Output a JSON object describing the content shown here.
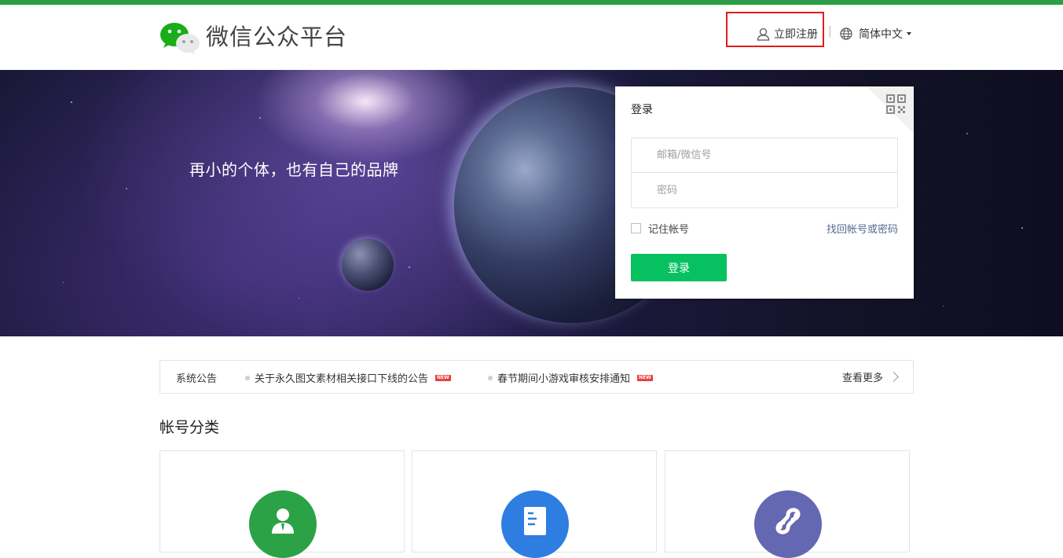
{
  "header": {
    "brand_name": "微信公众平台",
    "register_label": "立即注册",
    "separator": "|",
    "language": "简体中文"
  },
  "banner": {
    "slogan": "再小的个体，也有自己的品牌"
  },
  "login": {
    "title": "登录",
    "email_placeholder": "邮箱/微信号",
    "password_placeholder": "密码",
    "remember_label": "记住帐号",
    "forgot_label": "找回帐号或密码",
    "submit_label": "登录"
  },
  "notices": {
    "label": "系统公告",
    "items": [
      {
        "text": "关于永久图文素材相关接口下线的公告",
        "badge": "NEW"
      },
      {
        "text": "春节期间小游戏审核安排通知",
        "badge": "NEW"
      }
    ],
    "more_label": "查看更多"
  },
  "account_types": {
    "title": "帐号分类",
    "cards": [
      {
        "icon": "service-account-icon",
        "color": "#2ba245"
      },
      {
        "icon": "subscription-account-icon",
        "color": "#2e7de1"
      },
      {
        "icon": "mini-program-icon",
        "color": "#6467b2"
      }
    ]
  },
  "colors": {
    "primary_green": "#07c160",
    "link_blue": "#576b95",
    "highlight_red": "#e11b1b"
  }
}
